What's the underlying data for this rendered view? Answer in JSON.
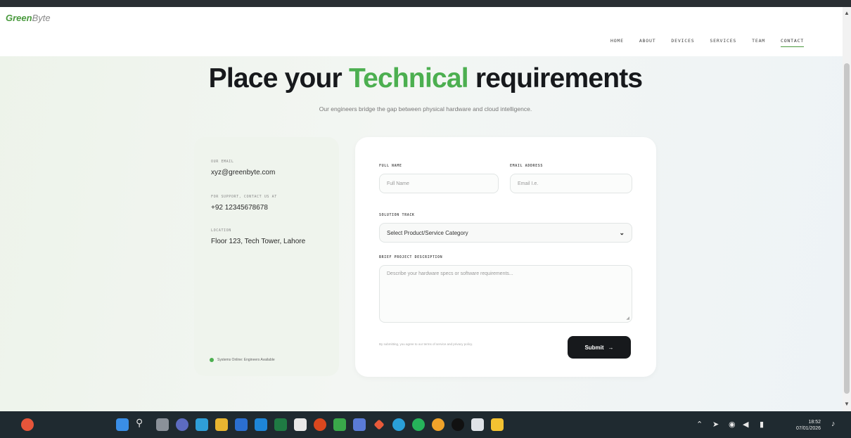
{
  "header": {
    "logo_green": "Green",
    "logo_grey": "Byte",
    "nav": [
      "HOME",
      "ABOUT",
      "DEVICES",
      "SERVICES",
      "TEAM",
      "CONTACT"
    ],
    "active_nav": "CONTACT"
  },
  "hero": {
    "title_pre": "Place your ",
    "title_accent": "Technical",
    "title_post": " requirements",
    "subtitle": "Our engineers bridge the gap between physical hardware and cloud intelligence."
  },
  "info": {
    "email_label": "OUR EMAIL",
    "email": "xyz@greenbyte.com",
    "support_label": "FOR SUPPORT, CONTACT US AT",
    "phone": "+92 12345678678",
    "location_label": "LOCATION",
    "location": "Floor 123, Tech Tower, Lahore",
    "status": "Systems Online: Engineers Available"
  },
  "form": {
    "fullname_label": "FULL NAME",
    "fullname_placeholder": "Full Name",
    "email_label": "EMAIL ADDRESS",
    "email_placeholder": "Email I.e.",
    "track_label": "SOLUTION TRACK",
    "track_value": "Select Product/Service Category",
    "desc_label": "BRIEF PROJECT DESCRIPTION",
    "desc_placeholder": "Describe your hardware specs or software requirements...",
    "note": "By submitting, you agree to our terms of service and privacy policy.",
    "submit_label": "Submit",
    "submit_arrow": "→"
  },
  "taskbar": {
    "time": "18:52",
    "date": "07/01/2026"
  },
  "colors": {
    "accent": "#4caf50",
    "dark": "#17191c"
  }
}
